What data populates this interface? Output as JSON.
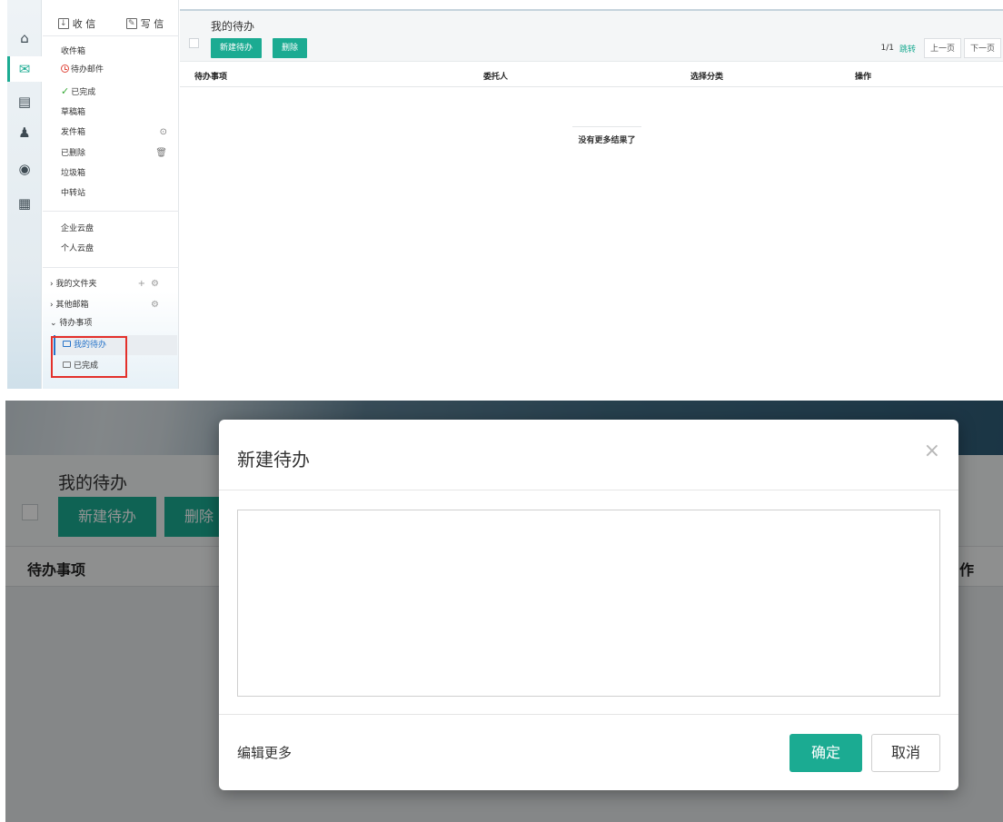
{
  "iconbar": {
    "items": [
      {
        "icon": "home-icon",
        "glyph": "⌂"
      },
      {
        "icon": "mail-icon",
        "glyph": "✉"
      },
      {
        "icon": "contacts-icon",
        "glyph": "▤"
      },
      {
        "icon": "add-user-icon",
        "glyph": "♟"
      },
      {
        "icon": "lifebuoy-icon",
        "glyph": "◉"
      },
      {
        "icon": "calendar-icon",
        "glyph": "▦"
      }
    ],
    "active_index": 1
  },
  "compose": {
    "receive_label": "收 信",
    "write_label": "写 信"
  },
  "folders": {
    "inbox": "收件箱",
    "pending": "待办邮件",
    "completed": "已完成",
    "drafts": "草稿箱",
    "sent": "发件箱",
    "deleted": "已删除",
    "trash": "垃圾箱",
    "relay": "中转站"
  },
  "cloud": {
    "enterprise": "企业云盘",
    "personal": "个人云盘"
  },
  "tree": {
    "my_folders": "我的文件夹",
    "other_mailboxes": "其他邮箱",
    "todo": "待办事项",
    "todo_children": {
      "mine": "我的待办",
      "done": "已完成"
    }
  },
  "main": {
    "title": "我的待办",
    "new_button": "新建待办",
    "delete_button": "删除",
    "pager": {
      "page": "1/1",
      "jump": "跳转",
      "prev": "上一页",
      "next": "下一页"
    },
    "columns": {
      "item": "待办事项",
      "assignee": "委托人",
      "category": "选择分类",
      "action": "操作"
    },
    "empty_text": "没有更多结果了"
  },
  "background_view": {
    "title": "我的待办",
    "new_button": "新建待办",
    "delete_button": "删除",
    "column_item": "待办事项",
    "column_cut": "作"
  },
  "modal": {
    "title": "新建待办",
    "close_glyph": "×",
    "textarea_value": "",
    "edit_more": "编辑更多",
    "ok": "确定",
    "cancel": "取消"
  },
  "colors": {
    "accent": "#1bab92",
    "highlight_border": "#e3302b",
    "link_blue": "#2774c9"
  }
}
